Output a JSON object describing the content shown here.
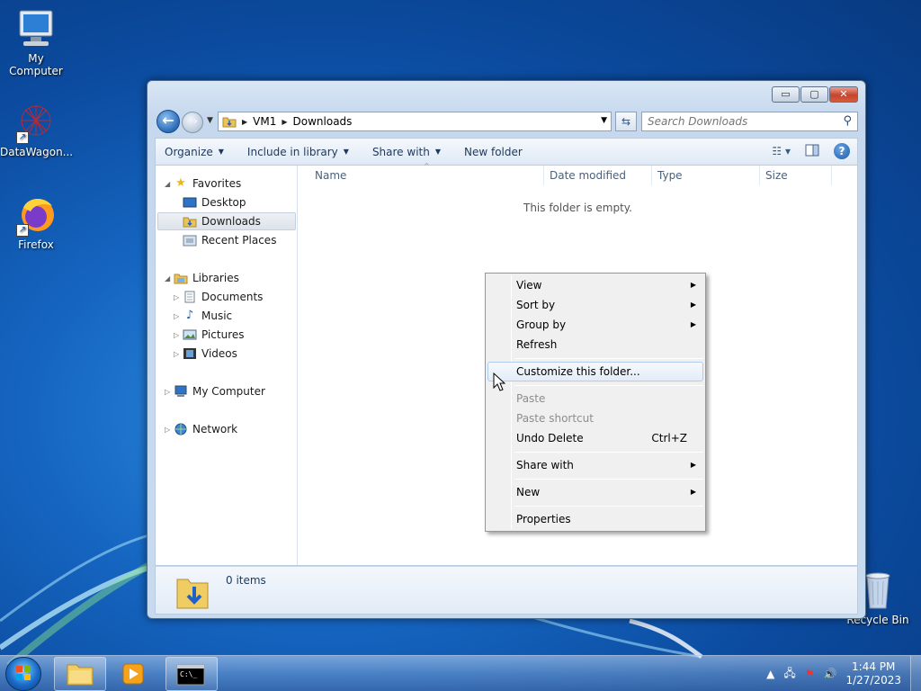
{
  "desktop": {
    "icons": [
      {
        "label": "My Computer",
        "icon": "computer-icon"
      },
      {
        "label": "DataWagon...",
        "icon": "datawagon-icon"
      },
      {
        "label": "Firefox",
        "icon": "firefox-icon"
      },
      {
        "label": "Recycle Bin",
        "icon": "recycle-bin-icon"
      }
    ]
  },
  "window": {
    "controls": {
      "minimize": "▭",
      "maximize": "▢",
      "close": "✕"
    },
    "address": {
      "crumbs": [
        "VM1",
        "Downloads"
      ]
    },
    "search": {
      "placeholder": "Search Downloads"
    },
    "toolbar": {
      "organize": "Organize",
      "include_in_library": "Include in library",
      "share_with": "Share with",
      "new_folder": "New folder"
    },
    "nav_pane": {
      "favorites": "Favorites",
      "desktop": "Desktop",
      "downloads": "Downloads",
      "recent_places": "Recent Places",
      "libraries": "Libraries",
      "documents": "Documents",
      "music": "Music",
      "pictures": "Pictures",
      "videos": "Videos",
      "my_computer": "My Computer",
      "network": "Network"
    },
    "columns": {
      "name": "Name",
      "date_modified": "Date modified",
      "type": "Type",
      "size": "Size"
    },
    "empty_message": "This folder is empty.",
    "status": {
      "items": "0 items"
    }
  },
  "context_menu": {
    "view": "View",
    "sort_by": "Sort by",
    "group_by": "Group by",
    "refresh": "Refresh",
    "customize": "Customize this folder...",
    "paste": "Paste",
    "paste_shortcut": "Paste shortcut",
    "undo_delete": "Undo Delete",
    "undo_delete_accel": "Ctrl+Z",
    "share_with": "Share with",
    "new": "New",
    "properties": "Properties"
  },
  "taskbar": {
    "clock_time": "1:44 PM",
    "clock_date": "1/27/2023"
  },
  "colors": {
    "desktop_bg": "#1565c0",
    "menu_bg": "#f0f0f0",
    "menu_hover_border": "#aecdf0",
    "toolbar_text": "#1e395b"
  }
}
